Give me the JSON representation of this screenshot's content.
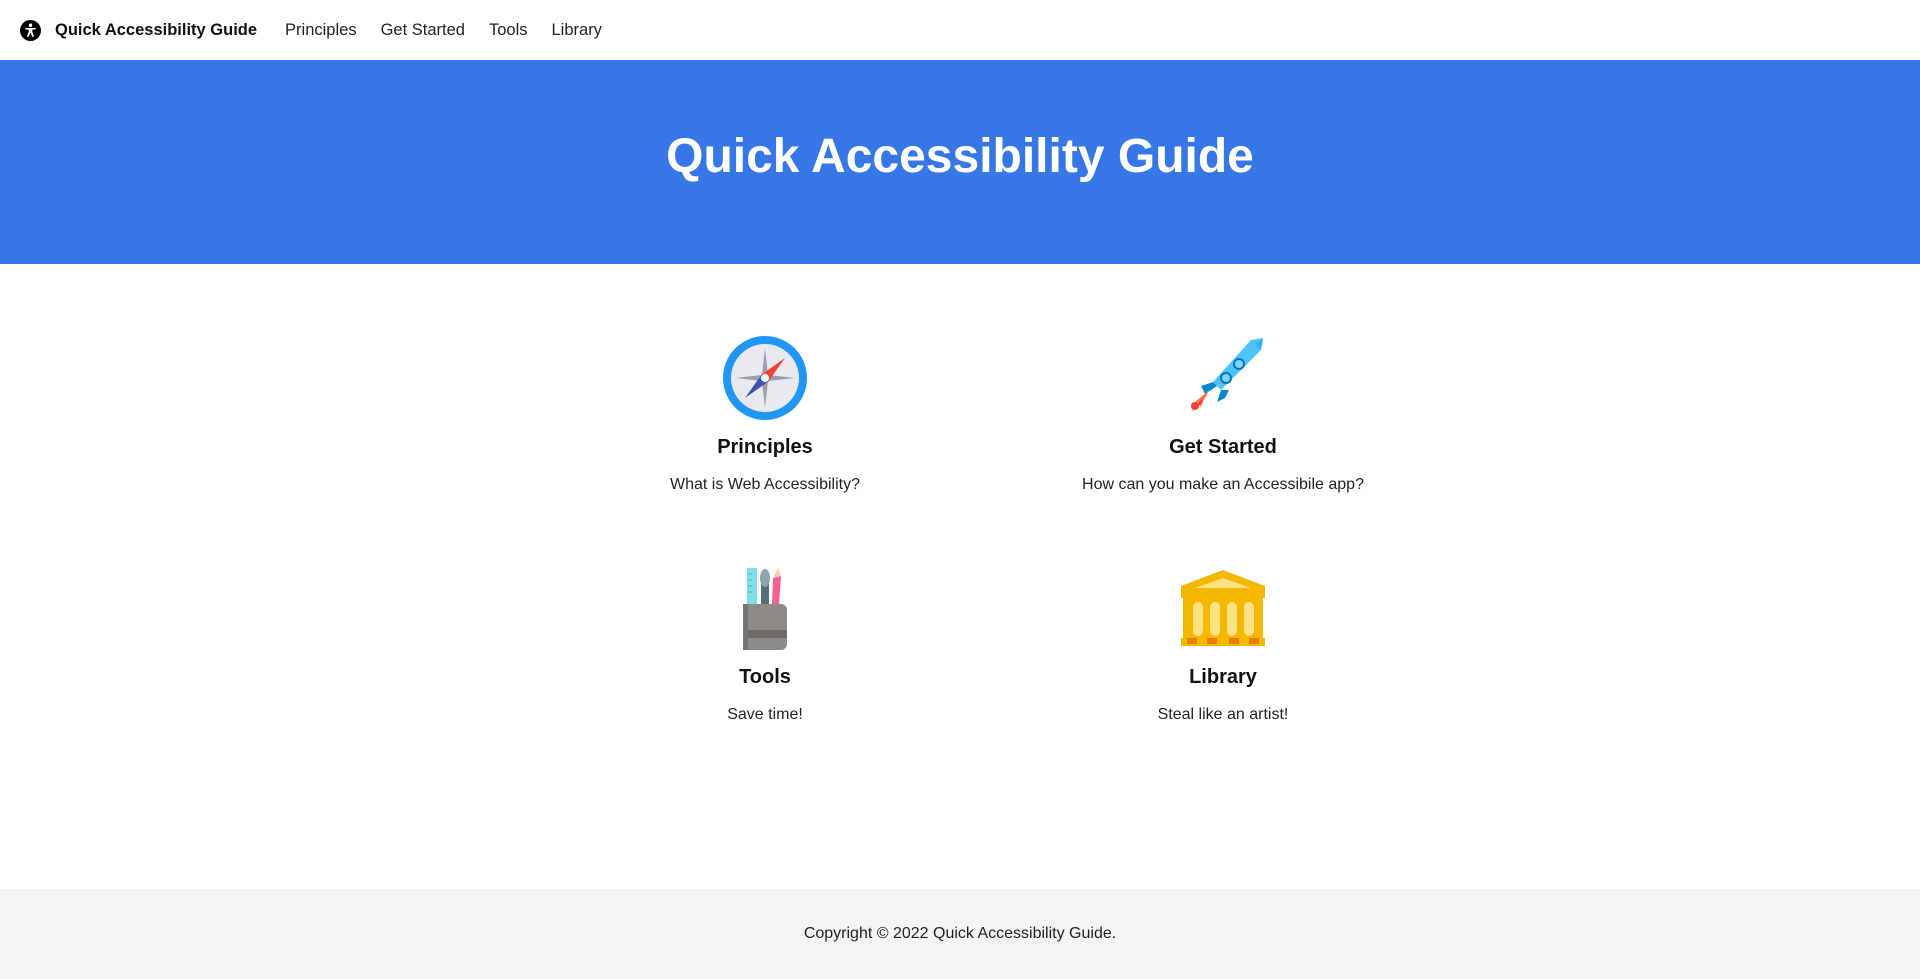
{
  "navbar": {
    "brand_icon": "accessibility-icon",
    "brand": "Quick Accessibility Guide",
    "links": [
      "Principles",
      "Get Started",
      "Tools",
      "Library"
    ]
  },
  "hero": {
    "title": "Quick Accessibility Guide",
    "background_color": "#3777e5"
  },
  "cards": [
    {
      "icon": "compass-icon",
      "title": "Principles",
      "description": "What is Web Accessibility?"
    },
    {
      "icon": "rocket-icon",
      "title": "Get Started",
      "description": "How can you make an Accessibile app?"
    },
    {
      "icon": "tools-cup-icon",
      "title": "Tools",
      "description": "Save time!"
    },
    {
      "icon": "library-building-icon",
      "title": "Library",
      "description": "Steal like an artist!"
    }
  ],
  "footer": {
    "copyright": "Copyright © 2022 Quick Accessibility Guide."
  }
}
